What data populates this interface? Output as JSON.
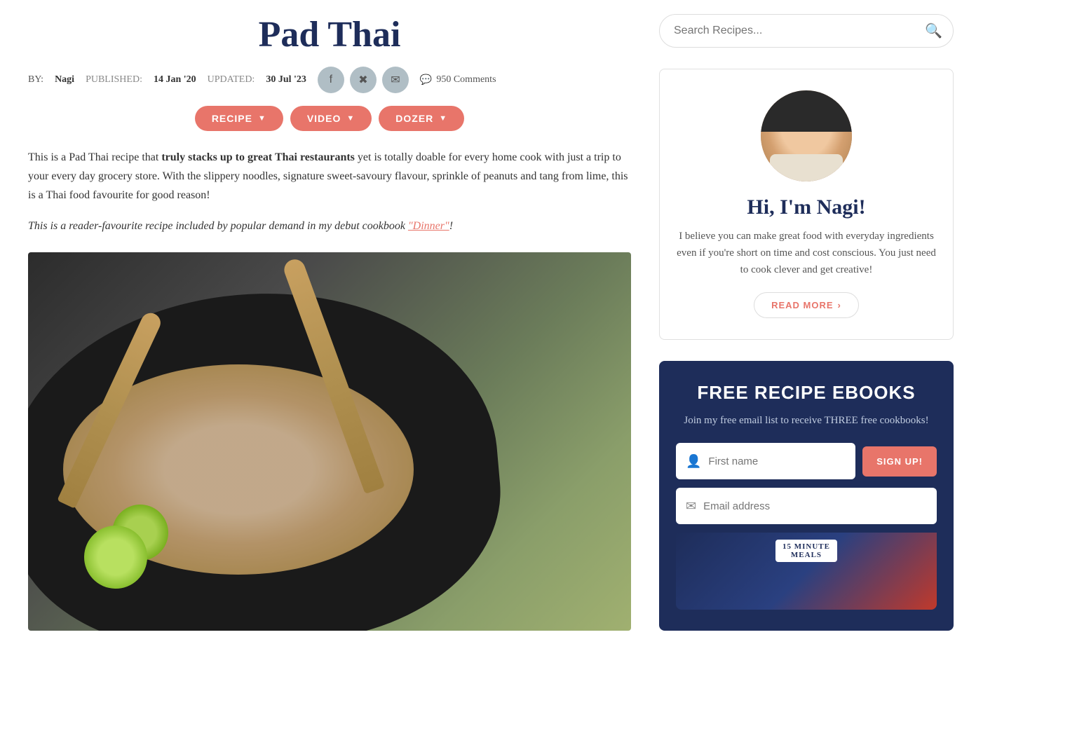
{
  "page": {
    "title": "Pad Thai"
  },
  "header": {
    "title": "Pad Thai",
    "by_label": "BY:",
    "author": "Nagi",
    "published_label": "PUBLISHED:",
    "published_date": "14 Jan '20",
    "updated_label": "UPDATED:",
    "updated_date": "30 Jul '23",
    "comments_count": "950 Comments"
  },
  "tabs": [
    {
      "label": "RECIPE",
      "id": "recipe"
    },
    {
      "label": "VIDEO",
      "id": "video"
    },
    {
      "label": "DOZER",
      "id": "dozer"
    }
  ],
  "intro": {
    "text_before_bold": "This is a Pad Thai recipe that ",
    "bold_text": "truly stacks up to great Thai restaurants",
    "text_after_bold": " yet is totally doable for every home cook with just a trip to your every day grocery store. With the slippery noodles, signature sweet-savoury flavour, sprinkle of peanuts and tang from lime, this is a Thai food favourite for good reason!",
    "reader_fav_before": "This is a reader-favourite recipe included by popular demand in my debut cookbook ",
    "cookbook_link": "\"Dinner\"",
    "reader_fav_after": "!"
  },
  "sidebar": {
    "search": {
      "placeholder": "Search Recipes..."
    },
    "author": {
      "greeting": "Hi, I'm Nagi!",
      "bio": "I believe you can make great food with everyday ingredients even if you're short on time and cost conscious. You just need to cook clever and get creative!",
      "read_more": "READ MORE"
    },
    "email_signup": {
      "title": "FREE RECIPE EBOOKS",
      "subtitle": "Join my free email list to receive THREE free cookbooks!",
      "first_name_placeholder": "First name",
      "email_placeholder": "Email address",
      "signup_button": "SIGN UP!",
      "book_label_line1": "15 MINUTE",
      "book_label_line2": "MEALS"
    }
  }
}
